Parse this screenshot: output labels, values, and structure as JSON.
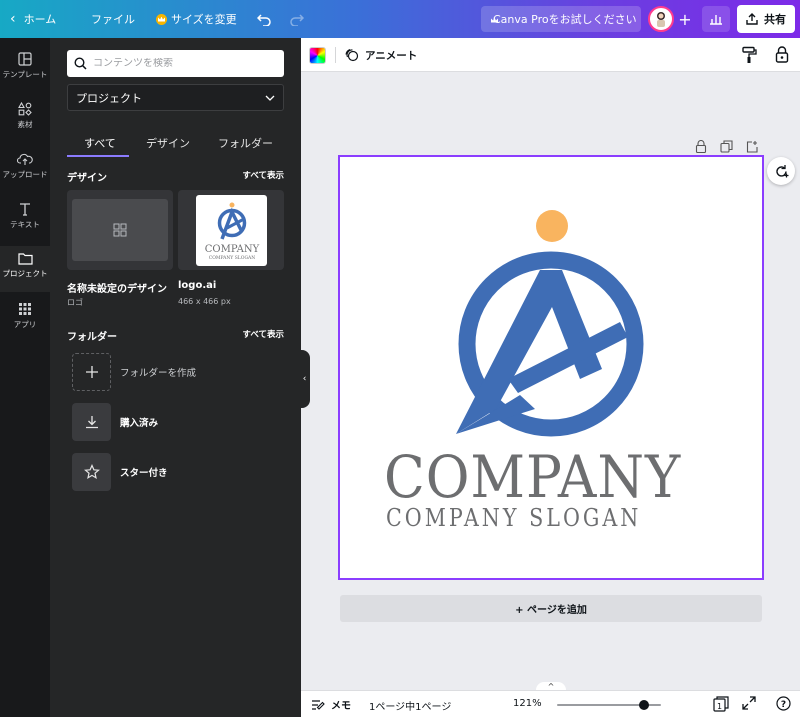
{
  "topbar": {
    "back_label": "ホーム",
    "file_label": "ファイル",
    "resize_label": "サイズを変更",
    "pro_label": "Canva Proをお試しください",
    "share_label": "共有"
  },
  "rail": {
    "items": [
      {
        "label": "テンプレート"
      },
      {
        "label": "素材"
      },
      {
        "label": "アップロード"
      },
      {
        "label": "テキスト"
      },
      {
        "label": "プロジェクト"
      },
      {
        "label": "アプリ"
      }
    ]
  },
  "panel": {
    "search_placeholder": "コンテンツを検索",
    "select_value": "プロジェクト",
    "tabs": [
      {
        "label": "すべて"
      },
      {
        "label": "デザイン"
      },
      {
        "label": "フォルダー"
      }
    ],
    "designs_heading": "デザイン",
    "designs_see_all": "すべて表示",
    "designs": [
      {
        "title": "名称未設定のデザイン",
        "subtitle": "ロゴ"
      },
      {
        "title": "logo.ai",
        "subtitle": "466 x 466 px"
      }
    ],
    "folders_heading": "フォルダー",
    "folders_see_all": "すべて表示",
    "folders": [
      {
        "label": "フォルダーを作成"
      },
      {
        "label": "購入済み"
      },
      {
        "label": "スター付き"
      }
    ]
  },
  "editor": {
    "animate_label": "アニメート",
    "logo_text_main": "COMPANY",
    "logo_text_slogan": "COMPANY SLOGAN",
    "thumb_text_main": "COMPANY",
    "thumb_text_slogan": "COMPANY SLOGAN",
    "add_page_label": "+ ページを追加"
  },
  "bottom": {
    "memo_label": "メモ",
    "pages_label": "1ページ中1ページ",
    "zoom_label": "121%",
    "zoom_value": 0.84,
    "page_count_badge": "1",
    "help_label": "?"
  },
  "colors": {
    "accent": "#8b3dff",
    "logo_blue": "#3f6db5",
    "logo_orange": "#f9b45f",
    "logo_gray": "#6d6e70"
  }
}
